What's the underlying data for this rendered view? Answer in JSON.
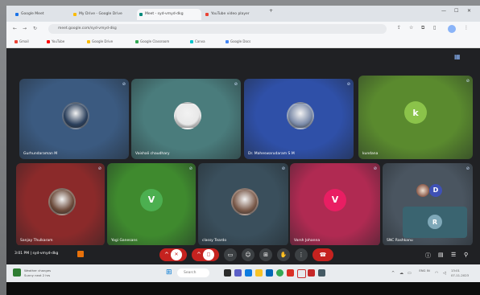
{
  "browser": {
    "tabs": [
      {
        "label": "Google Meet",
        "active": false
      },
      {
        "label": "My Drive - Google Drive",
        "active": false
      },
      {
        "label": "Meet - syd-vmyd-dkg",
        "active": true
      },
      {
        "label": "YouTube video player",
        "active": false
      }
    ],
    "url": "meet.google.com/syd-vmyd-dkg",
    "bookmarks": [
      "Gmail",
      "YouTube",
      "Google Drive",
      "Google Classroom",
      "Canva",
      "Google Docs"
    ]
  },
  "meeting": {
    "participants": [
      {
        "name": "Gurhundaraman M",
        "kind": "photo",
        "tile_color": "#3b5a80",
        "avatar_color": "#2a3f5c"
      },
      {
        "name": "Vaishali chaudhary",
        "kind": "photo",
        "tile_color": "#4a7c7c",
        "avatar_color": "#e8e8e8"
      },
      {
        "name": "Dr. Maheswarudaram S M",
        "kind": "photo",
        "tile_color": "#2f50a8",
        "avatar_color": "#7a8aa8"
      },
      {
        "name": "kundana",
        "kind": "letter",
        "letter": "k",
        "tile_color": "#5a8a2e",
        "avatar_color": "#8bc34a"
      },
      {
        "name": "Sanjay Thulkaram",
        "kind": "photo",
        "tile_color": "#8b2a2a",
        "avatar_color": "#6b4a3a"
      },
      {
        "name": "Yogi Ganesans",
        "kind": "letter",
        "letter": "V",
        "tile_color": "#3f8a2e",
        "avatar_color": "#4caf50"
      },
      {
        "name": "classy Teardo",
        "kind": "photo",
        "tile_color": "#3a4f5c",
        "avatar_color": "#7a5a4a"
      },
      {
        "name": "Varsh Johanna",
        "kind": "letter",
        "letter": "V",
        "tile_color": "#b02a52",
        "avatar_color": "#e91e63"
      },
      {
        "name": "SNC Rashkanu",
        "kind": "group",
        "tile_color": "#4a5560",
        "avatar_color": "#3f51b5",
        "letter": "D",
        "self_letter": "R"
      }
    ],
    "time": "3:01 PM",
    "code": "syd-vmyd-dkg"
  },
  "taskbar": {
    "weather": "Weather changes",
    "weather_sub": "Sunny next 2 hrs",
    "search": "Search",
    "lang": "ENG IN",
    "clock_time": "13:01",
    "clock_date": "07-11-2023"
  }
}
